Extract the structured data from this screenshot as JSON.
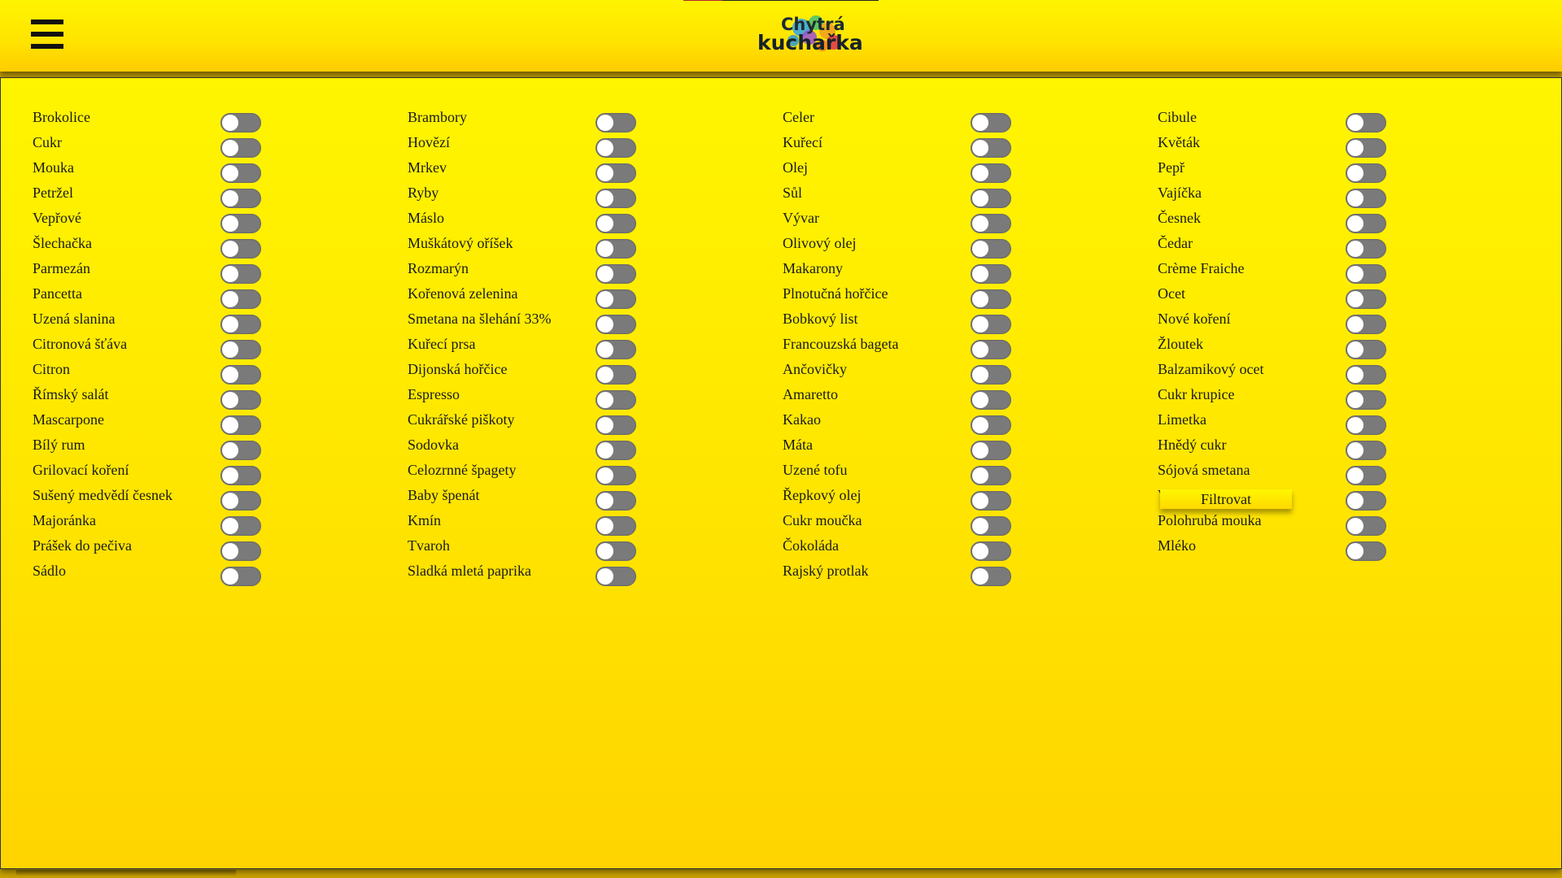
{
  "header": {
    "logo_line1": "Chytrá",
    "logo_line2": "kuchařka"
  },
  "ingredient_columns": [
    [
      "Brokolice",
      "Cukr",
      "Mouka",
      "Petržel",
      "Vepřové",
      "Šlechačka",
      "Parmezán",
      "Pancetta",
      "Uzená slanina",
      "Citronová šťáva",
      "Citron",
      "Římský salát",
      "Mascarpone",
      "Bílý rum",
      "Grilovací koření",
      "Sušený medvědí česnek",
      "Majoránka",
      "Prášek do pečiva",
      "Sádlo"
    ],
    [
      "Brambory",
      "Hovězí",
      "Mrkev",
      "Ryby",
      "Máslo",
      "Muškátový oříšek",
      "Rozmarýn",
      "Kořenová zelenina",
      "Smetana na šlehání 33%",
      "Kuřecí prsa",
      "Dijonská hořčice",
      "Espresso",
      "Cukrářské piškoty",
      "Sodovka",
      "Celozrnné špagety",
      "Baby špenát",
      "Kmín",
      "Tvaroh",
      "Sladká mletá paprika"
    ],
    [
      "Celer",
      "Kuřecí",
      "Olej",
      "Sůl",
      "Vývar",
      "Olivový olej",
      "Makarony",
      "Plnotučná hořčice",
      "Bobkový list",
      "Francouzská bageta",
      "Ančovičky",
      "Amaretto",
      "Kakao",
      "Máta",
      "Uzené tofu",
      "Řepkový olej",
      "Cukr moučka",
      "Čokoláda",
      "Rajský protlak"
    ],
    [
      "Cibule",
      "Květák",
      "Pepř",
      "Vajíčka",
      "Česnek",
      "Čedar",
      "Crème Fraiche",
      "Ocet",
      "Nové koření",
      "Žloutek",
      "Balzamikový ocet",
      "Cukr krupice",
      "Limetka",
      "Hnědý cukr",
      "Sójová smetana",
      "Voda",
      "Polohrubá mouka",
      "Mléko"
    ]
  ],
  "filter_button_label": "Filtrovat",
  "toggle_state": "off",
  "colors": {
    "bar_top": "#fff400",
    "bar_bottom": "#ffcc00",
    "toggle_track": "#7a7a7a",
    "toggle_knob": "#ffffff"
  },
  "icons": {
    "menu": "hamburger-icon",
    "logo": "logo-paint-splash"
  }
}
